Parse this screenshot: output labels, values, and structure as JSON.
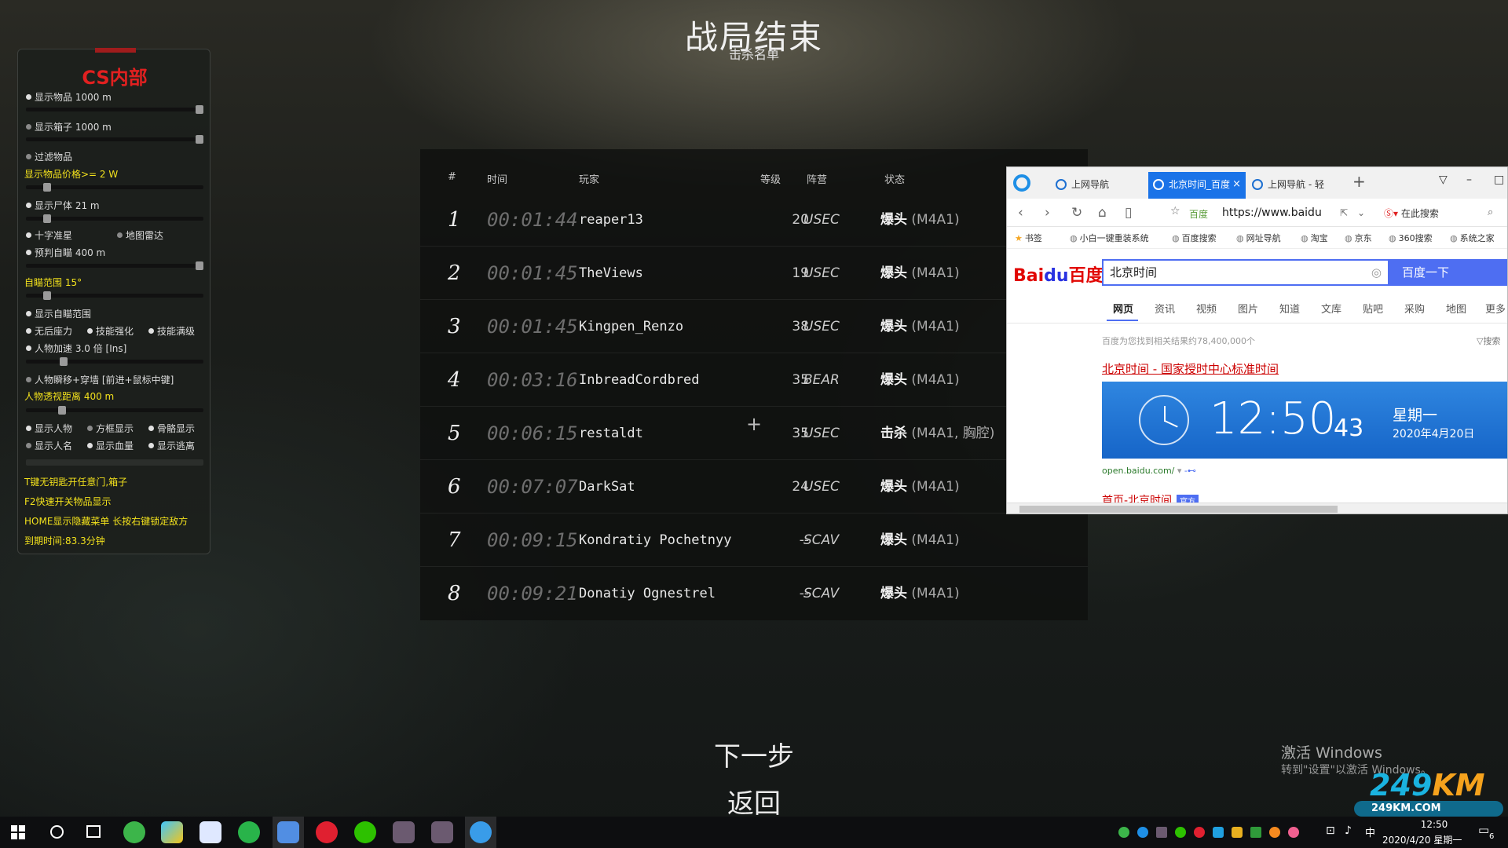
{
  "game": {
    "title": "战局结束",
    "subtitle": "击杀名单",
    "headers": {
      "num": "#",
      "time": "时间",
      "player": "玩家",
      "level": "等级",
      "side": "阵营",
      "status": "状态"
    },
    "kills": [
      {
        "num": "1",
        "time": "00:01:44",
        "player": "reaper13",
        "level": "20",
        "side": "USEC",
        "status": "爆头",
        "detail": "(M4A1)"
      },
      {
        "num": "2",
        "time": "00:01:45",
        "player": "TheViews",
        "level": "19",
        "side": "USEC",
        "status": "爆头",
        "detail": "(M4A1)"
      },
      {
        "num": "3",
        "time": "00:01:45",
        "player": "Kingpen_Renzo",
        "level": "38",
        "side": "USEC",
        "status": "爆头",
        "detail": "(M4A1)"
      },
      {
        "num": "4",
        "time": "00:03:16",
        "player": "InbreadCordbred",
        "level": "35",
        "side": "BEAR",
        "status": "爆头",
        "detail": "(M4A1)"
      },
      {
        "num": "5",
        "time": "00:06:15",
        "player": "restaldt",
        "level": "35",
        "side": "USEC",
        "status": "击杀",
        "detail": "(M4A1, 胸腔)"
      },
      {
        "num": "6",
        "time": "00:07:07",
        "player": "DarkSat",
        "level": "24",
        "side": "USEC",
        "status": "爆头",
        "detail": "(M4A1)"
      },
      {
        "num": "7",
        "time": "00:09:15",
        "player": "Kondratiy Pochetnyy",
        "level": "--",
        "side": "SCAV",
        "status": "爆头",
        "detail": "(M4A1)"
      },
      {
        "num": "8",
        "time": "00:09:21",
        "player": "Donatiy Ognestrel",
        "level": "--",
        "side": "SCAV",
        "status": "爆头",
        "detail": "(M4A1)"
      }
    ],
    "next_label": "下一步",
    "back_label": "返回"
  },
  "cheat": {
    "title": "CS内部",
    "opt_show_items": "显示物品 1000 m",
    "opt_show_boxes": "显示箱子 1000 m",
    "opt_filter_items": "过滤物品",
    "opt_item_price": "显示物品价格>= 2 W",
    "opt_show_bodies": "显示尸体 21 m",
    "opt_crosshair": "十字准星",
    "opt_map_radar": "地图雷达",
    "opt_predict_aim": "预判自瞄 400 m",
    "opt_aim_range": "自瞄范围 15°",
    "opt_show_aim_range": "显示自瞄范围",
    "opt_no_recoil": "无后座力",
    "opt_skill_boost": "技能强化",
    "opt_skill_max": "技能满级",
    "opt_speed": "人物加速 3.0 倍 [Ins]",
    "opt_teleport": "人物瞬移+穿墙 [前进+鼠标中键]",
    "opt_esp_distance": "人物透视距离 400 m",
    "opt_show_person": "显示人物",
    "opt_box_esp": "方框显示",
    "opt_skeleton": "骨骼显示",
    "opt_show_name": "显示人名",
    "opt_show_hp": "显示血量",
    "opt_show_exit": "显示逃离",
    "hint_t_key": "T键无钥匙开任意门,箱子",
    "hint_f2": "F2快速开关物品显示",
    "hint_home": "HOME显示隐藏菜单  长按右键锁定敌方",
    "expire": "到期时间:83.3分钟",
    "sliders": {
      "items": 1.0,
      "boxes": 1.0,
      "price": 0.1,
      "bodies": 0.1,
      "predict": 1.0,
      "aim_range": 0.1,
      "speed": 0.2,
      "esp_distance": 0.19
    }
  },
  "browser": {
    "tabs": {
      "tab1": "上网导航",
      "tab2": "北京时间_百度",
      "tab3": "上网导航 - 轻"
    },
    "url_prefix": "百度",
    "url": "https://www.baidu",
    "search_engine_label": "在此搜索",
    "bookmarks": {
      "bm0": "书签",
      "bm1": "小白一键重装系统",
      "bm2": "百度搜索",
      "bm3": "网址导航",
      "bm4": "淘宝",
      "bm5": "京东",
      "bm6": "360搜索",
      "bm7": "系统之家"
    },
    "logo_bai": "Bai",
    "logo_du": "du",
    "logo_cn": "百度",
    "query": "北京时间",
    "search_button": "百度一下",
    "search_tabs": {
      "web": "网页",
      "news": "资讯",
      "video": "视频",
      "image": "图片",
      "zhidao": "知道",
      "wenku": "文库",
      "tieba": "贴吧",
      "buy": "采购",
      "map": "地图",
      "more": "更多"
    },
    "result_count": "百度为您找到相关结果约78,400,000个",
    "filter": "搜索",
    "result_title": "北京时间 - 国家授时中心标准时间",
    "clock_time": "12:50",
    "clock_seconds": "43",
    "clock_weekday": "星期一",
    "clock_date": "2020年4月20日",
    "result_url": "open.baidu.com/",
    "result_title2": "首页-北京时间",
    "result_tag": "官方"
  },
  "watermark": {
    "activate_title": "激活 Windows",
    "activate_sub": "转到\"设置\"以激活 Windows。",
    "site_big": "249",
    "site_km": "KM",
    "site_small": "249KM.COM"
  },
  "taskbar": {
    "ime": "中",
    "time": "12:50",
    "date": "2020/4/20 星期一",
    "notification_count": "6"
  },
  "colors": {
    "cheat_title": "#e12020",
    "highlight_yellow": "#f2e11c",
    "baidu_blue": "#4e6ef2",
    "baidu_red": "#e10602",
    "tab_active": "#1a73e8"
  }
}
